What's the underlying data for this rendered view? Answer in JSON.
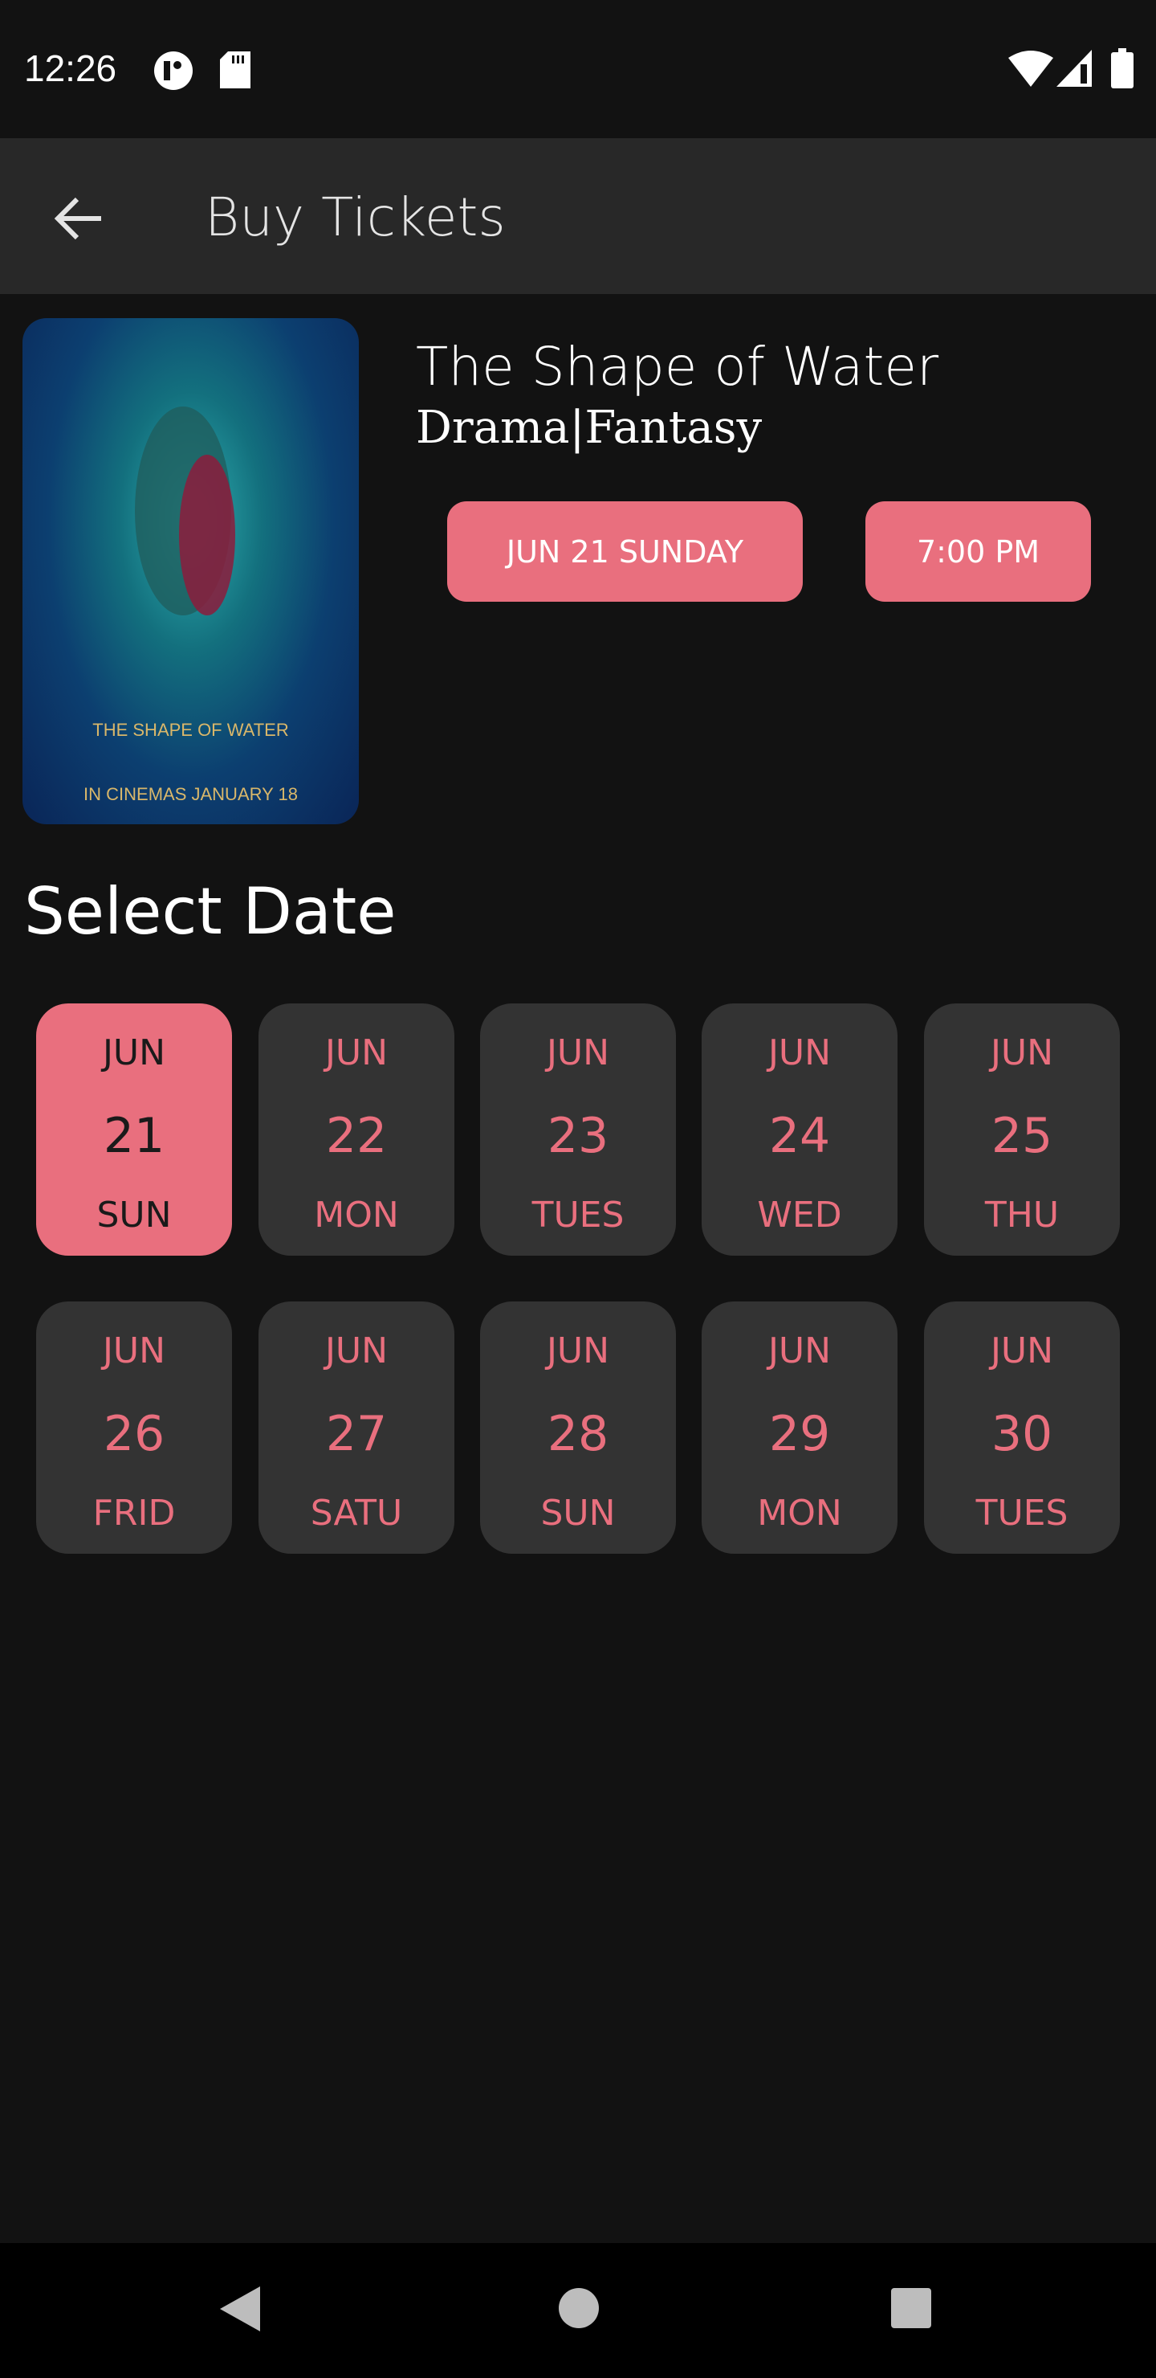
{
  "status_bar": {
    "time": "12:26"
  },
  "app_bar": {
    "title": "Buy Tickets"
  },
  "movie": {
    "title": "The Shape of Water",
    "genre": "Drama|Fantasy",
    "poster_text": "THE SHAPE OF WATER",
    "poster_tagline": "IN CINEMAS JANUARY 18",
    "selected_date_label": "JUN 21 SUNDAY",
    "selected_time_label": "7:00 PM"
  },
  "select_date": {
    "heading": "Select Date",
    "dates": [
      {
        "month": "JUN",
        "day": "21",
        "weekday": "SUN",
        "selected": true
      },
      {
        "month": "JUN",
        "day": "22",
        "weekday": "MON"
      },
      {
        "month": "JUN",
        "day": "23",
        "weekday": "TUES"
      },
      {
        "month": "JUN",
        "day": "24",
        "weekday": "WED"
      },
      {
        "month": "JUN",
        "day": "25",
        "weekday": "THU"
      },
      {
        "month": "JUN",
        "day": "26",
        "weekday": "FRID"
      },
      {
        "month": "JUN",
        "day": "27",
        "weekday": "SATU"
      },
      {
        "month": "JUN",
        "day": "28",
        "weekday": "SUN"
      },
      {
        "month": "JUN",
        "day": "29",
        "weekday": "MON"
      },
      {
        "month": "JUN",
        "day": "30",
        "weekday": "TUES"
      }
    ]
  },
  "colors": {
    "accent": "#e96f7e",
    "background": "#121212",
    "card": "#333333",
    "app_bar": "#282828"
  }
}
